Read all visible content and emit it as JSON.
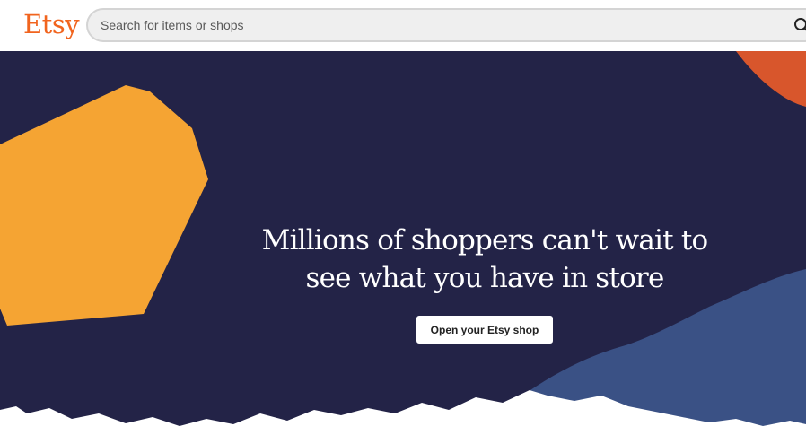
{
  "header": {
    "logo": "Etsy",
    "search": {
      "placeholder": "Search for items or shops",
      "value": "",
      "icon": "search-icon"
    }
  },
  "hero": {
    "headline_line1": "Millions of shoppers can't wait to",
    "headline_line2": "see what you have in store",
    "cta_label": "Open your Etsy shop",
    "colors": {
      "background": "#232347",
      "orange_shape": "#f5a433",
      "red_shape": "#d8562c",
      "blue_hill": "#3a5185",
      "paper_white": "#ffffff",
      "brand": "#f1641e"
    }
  }
}
